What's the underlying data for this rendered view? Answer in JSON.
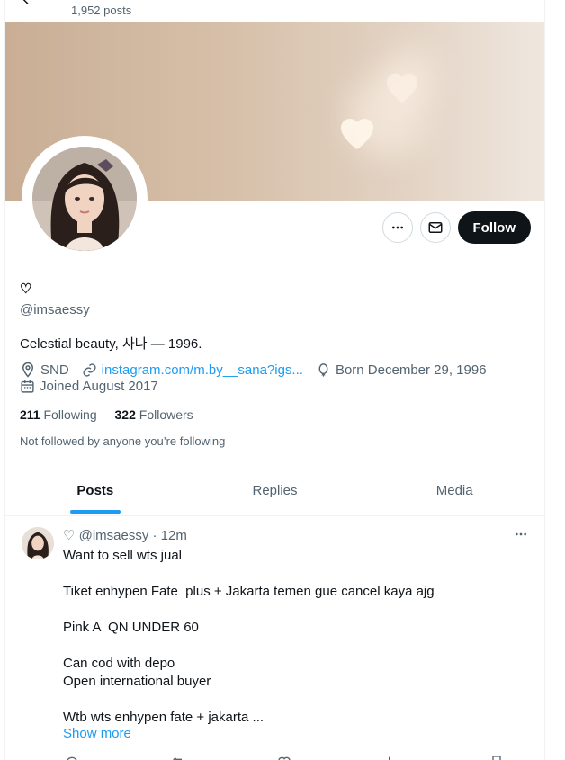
{
  "header": {
    "post_count": "1,952 posts"
  },
  "profile": {
    "name": "♡",
    "handle": "@imsaessy",
    "bio": "Celestial beauty, 사나 — 1996.",
    "location": "SND",
    "link": "instagram.com/m.by__sana?igs...",
    "birthday": "Born December 29, 1996",
    "joined": "Joined August 2017",
    "following_count": "211",
    "following_label": "Following",
    "followers_count": "322",
    "followers_label": "Followers",
    "not_followed": "Not followed by anyone you’re following",
    "follow_button": "Follow"
  },
  "tabs": [
    {
      "label": "Posts",
      "active": true
    },
    {
      "label": "Replies",
      "active": false
    },
    {
      "label": "Media",
      "active": false
    }
  ],
  "tweet": {
    "header": "♡ @imsaessy · 12m",
    "lines": [
      "Want to sell wts jual",
      "",
      "Tiket enhypen Fate  plus + Jakarta temen gue cancel kaya ajg",
      "",
      "Pink A  QN UNDER 60",
      "",
      "Can cod with depo",
      "Open international buyer",
      "",
      "Wtb wts enhypen fate + jakarta ..."
    ],
    "show_more": "Show more"
  },
  "colors": {
    "accent": "#1d9bf0",
    "text": "#0f1419",
    "muted": "#536471",
    "follow_bg": "#0f1419"
  },
  "icons": [
    "back-arrow-icon",
    "more-icon",
    "message-icon",
    "location-icon",
    "link-icon",
    "balloon-icon",
    "calendar-icon"
  ]
}
